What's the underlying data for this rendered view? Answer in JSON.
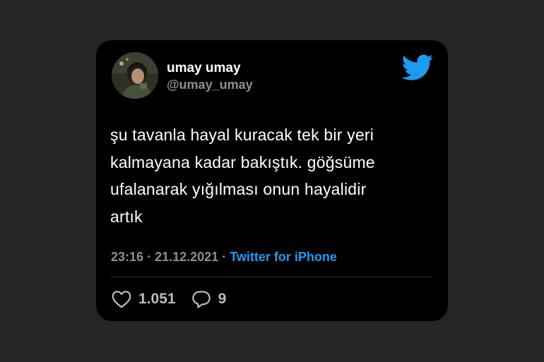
{
  "tweet": {
    "display_name": "umay umay",
    "handle": "@umay_umay",
    "text_lines": [
      "şu tavanla hayal kuracak tek bir yeri",
      "kalmayana kadar bakıştık. göğsüme",
      "ufalanarak yığılması onun hayalidir",
      "artık"
    ],
    "time": "23:16",
    "separator": "·",
    "date": "21.12.2021",
    "source": "Twitter for iPhone",
    "likes": "1.051",
    "replies": "9"
  },
  "icons": {
    "brand": "twitter-bird-icon",
    "like": "heart-icon",
    "reply": "speech-bubble-icon"
  },
  "colors": {
    "background": "#252525",
    "card": "#000000",
    "accent": "#1d9bf0",
    "secondary_text": "#8b8f94"
  }
}
